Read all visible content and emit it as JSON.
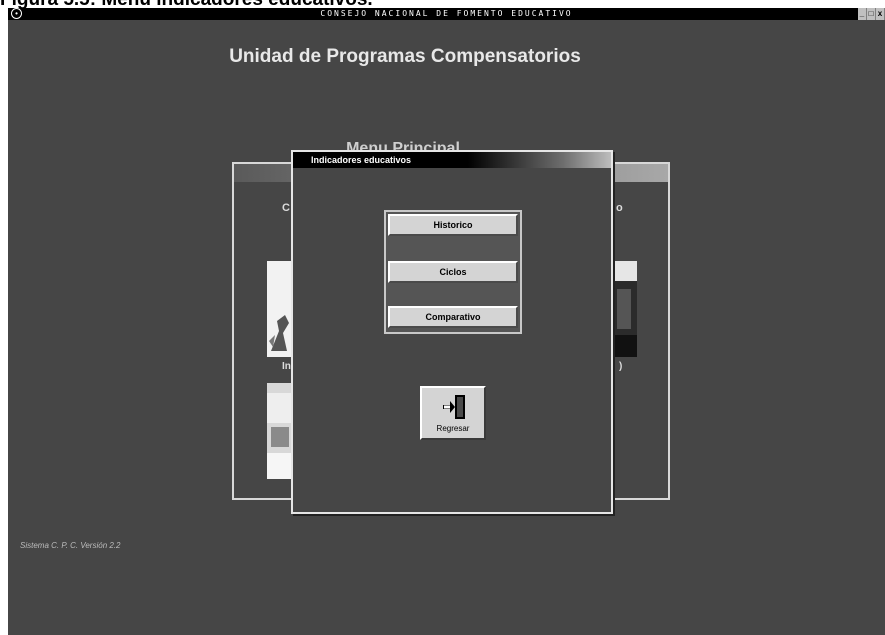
{
  "caption": "Figura 5.5: Menú indicadores educativos.",
  "window": {
    "title": "CONSEJO NACIONAL DE FOMENTO EDUCATIVO",
    "sys_icon": "circle-icon",
    "controls": [
      "_",
      "□",
      "x"
    ]
  },
  "app": {
    "title": "Unidad de Programas Compensatorios",
    "version": "Sistema C. P. C. Versión 2.2"
  },
  "background_menu": {
    "title": "Menu Principal",
    "label_left_top": "C",
    "label_right_top": "o",
    "label_left_mid": "In",
    "label_right_mid": ")"
  },
  "dialog": {
    "title": "Indicadores educativos",
    "buttons": [
      {
        "label": "Historico"
      },
      {
        "label": "Ciclos"
      },
      {
        "label": "Comparativo"
      }
    ],
    "exit": {
      "label": "Regresar",
      "icon": "exit-door-icon"
    }
  },
  "colors": {
    "desktop": "#464646",
    "titlebar": "#000000",
    "button_face": "#d4d4d4"
  }
}
